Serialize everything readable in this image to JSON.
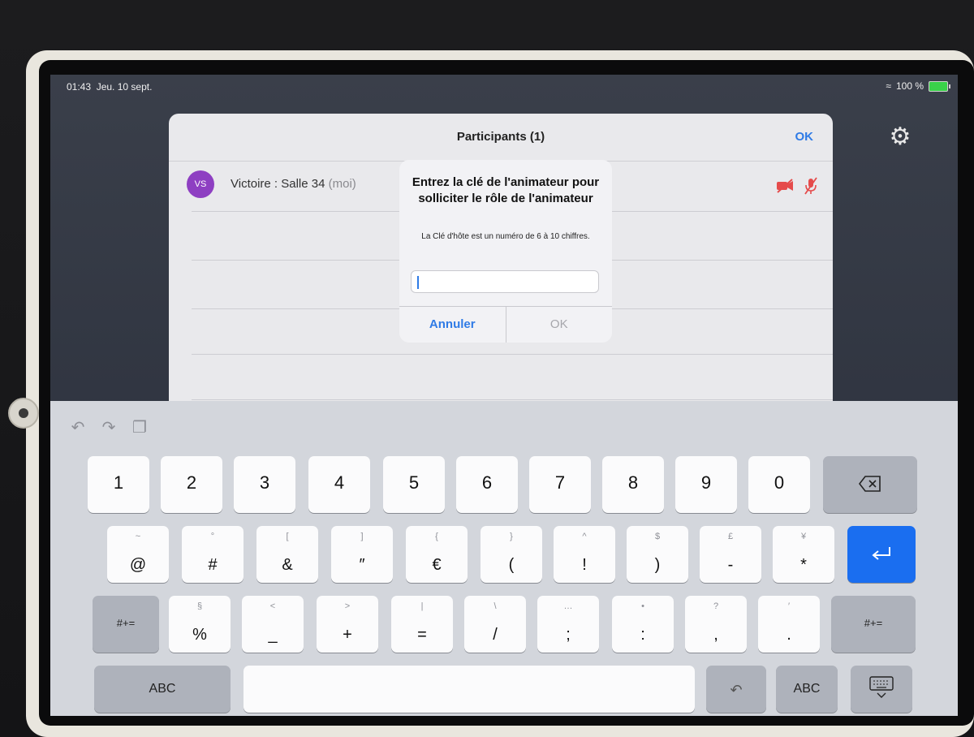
{
  "status_bar": {
    "time": "01:43",
    "date": "Jeu. 10 sept.",
    "battery": "100 %"
  },
  "participants_sheet": {
    "title": "Participants (1)",
    "ok_label": "OK",
    "participant": {
      "initials": "VS",
      "name": "Victoire : Salle 34",
      "self_tag": "(moi)",
      "avatar_color": "#8e3fc2"
    }
  },
  "alert": {
    "title": "Entrez la clé de l'animateur pour solliciter le rôle de l'animateur",
    "message": "La Clé d'hôte est un numéro de 6 à 10 chiffres.",
    "input_value": "",
    "cancel_label": "Annuler",
    "ok_label": "OK"
  },
  "keyboard": {
    "row1": [
      "1",
      "2",
      "3",
      "4",
      "5",
      "6",
      "7",
      "8",
      "9",
      "0"
    ],
    "row2": [
      {
        "sub": "~",
        "main": "@"
      },
      {
        "sub": "°",
        "main": "#"
      },
      {
        "sub": "[",
        "main": "&"
      },
      {
        "sub": "]",
        "main": "″"
      },
      {
        "sub": "{",
        "main": "€"
      },
      {
        "sub": "}",
        "main": "("
      },
      {
        "sub": "^",
        "main": "!"
      },
      {
        "sub": "$",
        "main": ")"
      },
      {
        "sub": "£",
        "main": "-"
      },
      {
        "sub": "¥",
        "main": "*"
      }
    ],
    "row3": [
      {
        "sub": "§",
        "main": "%"
      },
      {
        "sub": "<",
        "main": "_"
      },
      {
        "sub": ">",
        "main": "+"
      },
      {
        "sub": "|",
        "main": "="
      },
      {
        "sub": "\\",
        "main": "/"
      },
      {
        "sub": "…",
        "main": ";"
      },
      {
        "sub": "•",
        "main": ":"
      },
      {
        "sub": "?",
        "main": ","
      },
      {
        "sub": "′",
        "main": "."
      }
    ],
    "shift_left": "#+=",
    "shift_right": "#+=",
    "abc_left": "ABC",
    "abc_right": "ABC",
    "accent": "#1a6ef0"
  }
}
